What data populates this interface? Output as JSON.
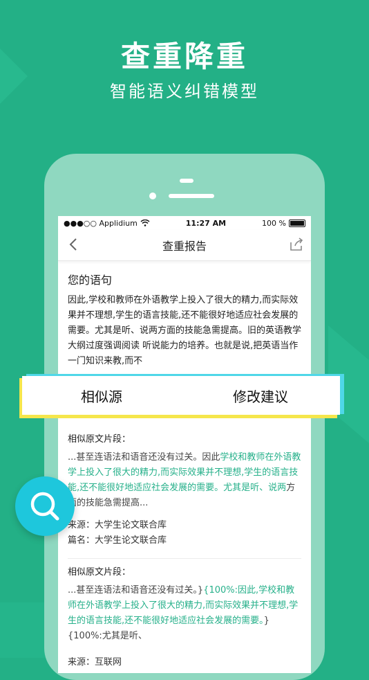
{
  "hero": {
    "title": "查重降重",
    "subtitle": "智能语义纠错模型"
  },
  "status_bar": {
    "carrier": "●●●○○ Applidium",
    "time": "11:27 AM",
    "battery": "100 %"
  },
  "nav": {
    "title": "查重报告"
  },
  "your_sentence": {
    "heading": "您的语句",
    "text": "因此,学校和教师在外语教学上投入了很大的精力,而实际效果并不理想,学生的语言技能,还不能很好地适应社会发展的需要。尤其是听、说两方面的技能急需提高。旧的英语教学大纲过度强调阅读 听说能力的培养。也就是说,把英语当作一门知识来教,而不"
  },
  "tabs": {
    "similar": "相似源",
    "suggest": "修改建议"
  },
  "results": [
    {
      "heading": "相似原文片段：",
      "prefix": "...甚至连语法和语音还没有过关。因此",
      "highlight": "学校和教师在外语教学上投入了很大的精力,而实际效果并不理想,学生的语言技能,还不能很好地适应社会发展的需要。尤其是听、说两",
      "suffix": "方面的技能急需提高...",
      "source": "来源：大学生论文联合库",
      "title": "篇名：大学生论文联合库"
    },
    {
      "heading": "相似原文片段：",
      "prefix": "...甚至连语法和语音还没有过关。}",
      "highlight": "{100%:因此,学校和教师在外语教学上投入了很大的精力,而实际效果并不理想,学生的语言技能,还不能很好地适应社会发展的需要。",
      "suffix": "}{100%:尤其是听、",
      "source": "来源：互联网"
    }
  ],
  "colors": {
    "brand": "#23b086",
    "highlight": "#26b08a",
    "fab": "#1ec7dc"
  },
  "icons": {
    "back": "chevron-left-icon",
    "share": "share-icon",
    "fab": "search-icon"
  }
}
